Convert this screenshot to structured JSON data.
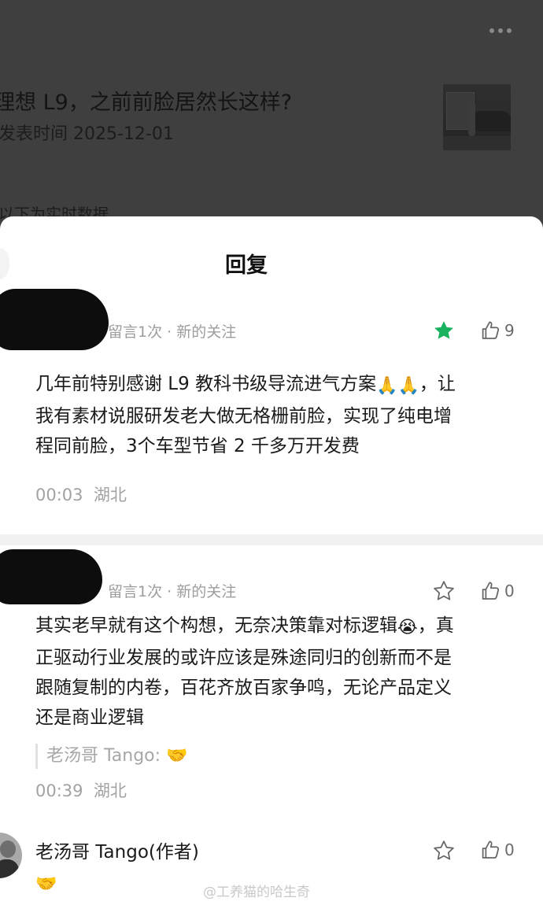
{
  "background": {
    "article_title": "理想 L9，之前前脸居然长这样?",
    "publish_date": "发表时间 2025-12-01",
    "data_note": "以下为实时数据"
  },
  "sheet": {
    "title": "回复"
  },
  "comments": [
    {
      "meta": "留言1次 · 新的关注",
      "starred": true,
      "likes": "9",
      "lines": [
        "几年前特别感谢 L9 教科书级导流进气方案",
        "我有素材说服研发老大做无格栅前脸，实现了纯电增",
        "程同前脸，3个车型节省 2 千多万开发费"
      ],
      "line1_tail": "，让",
      "emoji": "🙏🙏",
      "time": "00:03",
      "location": "湖北"
    },
    {
      "meta": "留言1次 · 新的关注",
      "starred": false,
      "likes": "0",
      "lines": [
        "其实老早就有这个构想，无奈决策靠对标逻辑",
        "正驱动行业发展的或许应该是殊途同归的创新而不是",
        "跟随复制的内卷，百花齐放百家争鸣，无论产品定义",
        "还是商业逻辑"
      ],
      "line1_tail": "，真",
      "emoji": "😭",
      "reply_quote": "老汤哥 Tango:",
      "reply_emoji": "🤝",
      "time": "00:39",
      "location": "湖北"
    }
  ],
  "author_reply": {
    "name": "老汤哥 Tango(作者)",
    "content_emoji": "🤝",
    "likes": "0"
  },
  "watermark": "@工养猫的哈生奇"
}
